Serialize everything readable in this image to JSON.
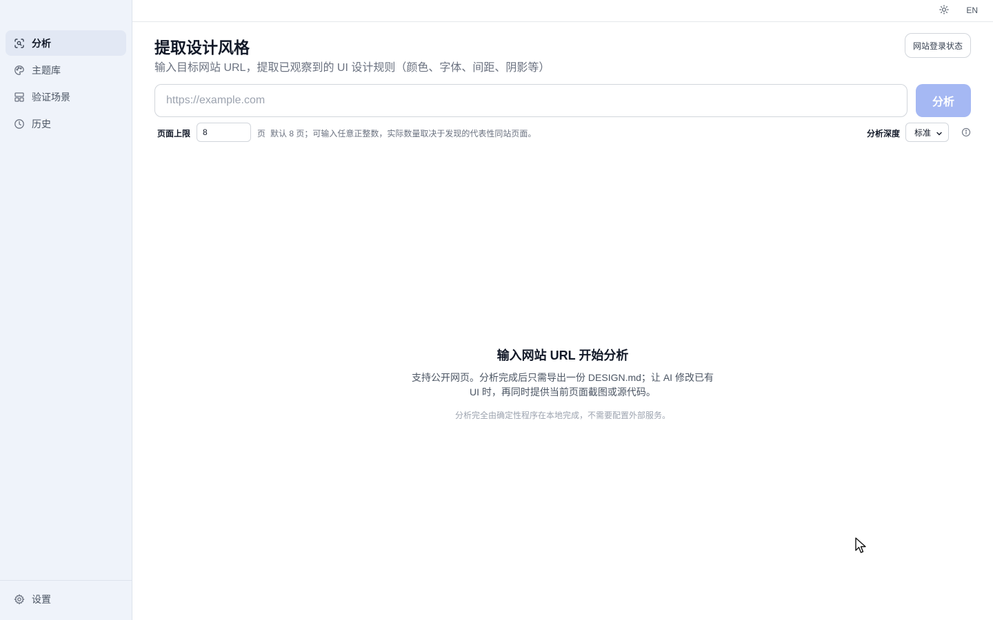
{
  "sidebar": {
    "items": [
      {
        "label": "分析",
        "icon": "scan-search-icon",
        "active": true
      },
      {
        "label": "主题库",
        "icon": "palette-icon"
      },
      {
        "label": "验证场景",
        "icon": "layout-icon"
      },
      {
        "label": "历史",
        "icon": "clock-icon"
      }
    ],
    "settings": {
      "label": "设置",
      "icon": "gear-icon"
    }
  },
  "topbar": {
    "theme_icon": "sun-icon",
    "lang": "EN"
  },
  "main": {
    "title": "提取设计风格",
    "subtitle": "输入目标网站 URL，提取已观察到的 UI 设计规则（颜色、字体、间距、阴影等）",
    "login_button": "网站登录状态",
    "url_placeholder": "https://example.com",
    "analyze_button": "分析",
    "page_limit_label": "页面上限",
    "page_limit_value": "8",
    "page_unit": "页",
    "page_hint": "默认 8 页；可输入任意正整数，实际数量取决于发现的代表性同站页面。",
    "depth_label": "分析深度",
    "depth_value": "标准"
  },
  "empty_state": {
    "title": "输入网站 URL 开始分析",
    "description": "支持公开网页。分析完成后只需导出一份 DESIGN.md；让 AI 修改已有 UI 时，再同时提供当前页面截图或源代码。",
    "note": "分析完全由确定性程序在本地完成，不需要配置外部服务。"
  },
  "colors": {
    "sidebar_bg": "#eff3fa",
    "active_item_bg": "#e2e8f4",
    "primary_disabled": "#a5b8f3"
  }
}
